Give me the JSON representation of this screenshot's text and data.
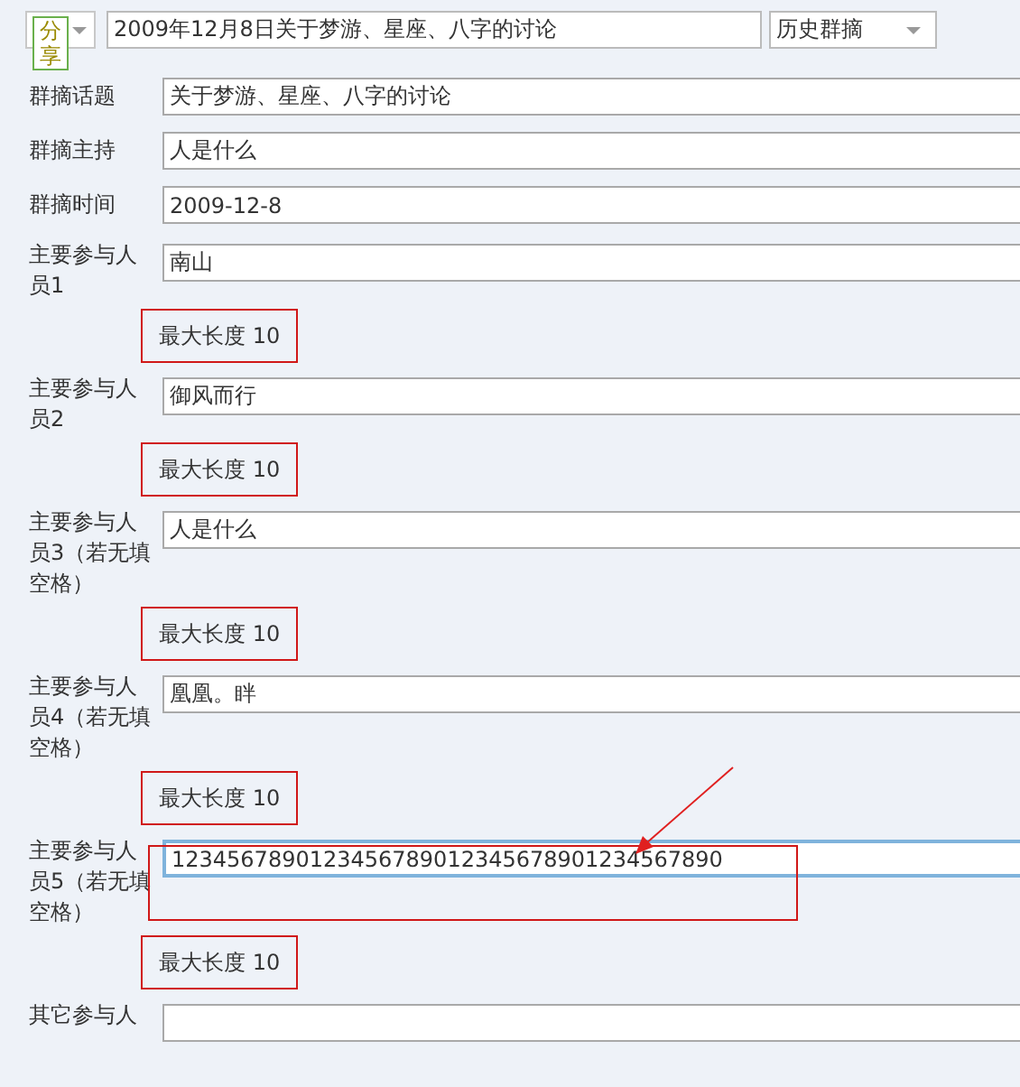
{
  "header": {
    "share_button": {
      "label": "分享"
    },
    "title_field": {
      "value": "2009年12月8日关于梦游、星座、八字的讨论"
    },
    "category_select": {
      "value": "历史群摘"
    }
  },
  "fields": [
    {
      "kind": "simple",
      "label": "群摘话题",
      "value": "关于梦游、星座、八字的讨论",
      "focused": false,
      "highlighted": false
    },
    {
      "kind": "simple",
      "label": "群摘主持",
      "value": "人是什么",
      "focused": false,
      "highlighted": false
    },
    {
      "kind": "simple",
      "label": "群摘时间",
      "value": "2009-12-8",
      "focused": false,
      "highlighted": false
    },
    {
      "kind": "person",
      "label": "主要参与人员1",
      "value": "南山",
      "focused": false,
      "highlighted": false,
      "hint": "最大长度 10"
    },
    {
      "kind": "person",
      "label": "主要参与人员2",
      "value": "御风而行",
      "focused": false,
      "highlighted": false,
      "hint": "最大长度 10"
    },
    {
      "kind": "person",
      "label": "主要参与人员3（若无填空格）",
      "value": "人是什么",
      "focused": false,
      "highlighted": false,
      "hint": "最大长度 10"
    },
    {
      "kind": "person",
      "label": "主要参与人员4（若无填空格）",
      "value": "凰凰。眫",
      "focused": false,
      "highlighted": false,
      "hint": "最大长度 10"
    },
    {
      "kind": "person",
      "label": "主要参与人员5（若无填空格）",
      "value": "1234567890123456789012345678901234567890",
      "focused": true,
      "highlighted": true,
      "hint": "最大长度 10"
    },
    {
      "kind": "person",
      "label": "其它参与人",
      "focused": false,
      "highlighted": false
    }
  ]
}
